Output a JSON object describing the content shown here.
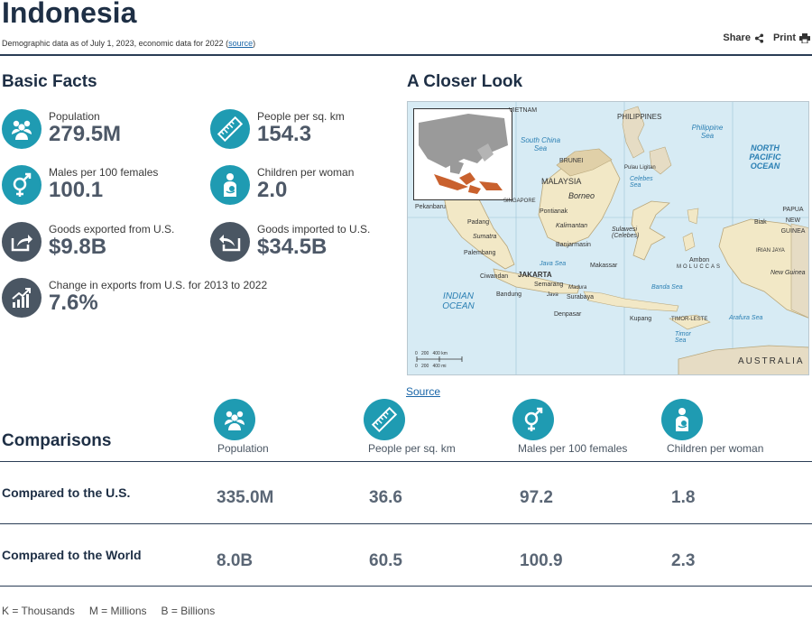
{
  "header": {
    "title": "Indonesia",
    "subtitle_prefix": "Demographic data as of July 1, 2023, economic data for 2022 (",
    "subtitle_link": "source",
    "subtitle_suffix": ")",
    "share_label": "Share",
    "print_label": "Print"
  },
  "basic_facts": {
    "heading": "Basic Facts",
    "items": [
      {
        "label": "Population",
        "value": "279.5M",
        "icon": "people-icon"
      },
      {
        "label": "People per sq. km",
        "value": "154.3",
        "icon": "ruler-icon"
      },
      {
        "label": "Males per 100 females",
        "value": "100.1",
        "icon": "gender-icon"
      },
      {
        "label": "Children per woman",
        "value": "2.0",
        "icon": "mother-child-icon"
      },
      {
        "label": "Goods exported from U.S.",
        "value": "$9.8B",
        "icon": "export-icon"
      },
      {
        "label": "Goods imported to U.S.",
        "value": "$34.5B",
        "icon": "import-icon"
      },
      {
        "label": "Change in exports from U.S. for 2013 to 2022",
        "value": "7.6%",
        "icon": "trend-chart-icon"
      }
    ]
  },
  "closer_look": {
    "heading": "A Closer Look",
    "source_link": "Source",
    "map_labels": {
      "philippines": "PHILIPPINES",
      "philippine_sea": "Philippine Sea",
      "south_china_sea": "South China Sea",
      "north_pacific": "NORTH PACIFIC OCEAN",
      "malaysia": "MALAYSIA",
      "borneo": "Borneo",
      "brunei": "BRUNEI",
      "celebes_sea": "Celebes Sea",
      "pulau": "Pulau Ligitan",
      "singapore": "SINGAPORE",
      "pekanbaru": "Pekanbaru",
      "padang": "Padang",
      "sumatra": "Sumatra",
      "palembang": "Palembang",
      "pontianak": "Pontianak",
      "kalimantan": "Kalimantan",
      "banjarmasin": "Banjarmasin",
      "sulawesi": "Sulawesi (Celebes)",
      "biak": "Biak",
      "papua": "PAPUA NEW GUINEA",
      "irian": "IRIAN JAYA",
      "new_guinea": "New Guinea",
      "ambon": "Ambon",
      "makassar": "Makassar",
      "moluccas": "MOLUCCAS",
      "java_sea": "Java Sea",
      "banda_sea": "Banda Sea",
      "jakarta": "JAKARTA",
      "ciwandan": "Ciwandan",
      "semarang": "Semarang",
      "bandung": "Bandung",
      "surabaya": "Surabaya",
      "java": "Java",
      "madura": "Madura",
      "denpasar": "Denpasar",
      "kupang": "Kupang",
      "timor_leste": "TIMOR-LESTE",
      "timor_sea": "Timor Sea",
      "arafura": "Arafura Sea",
      "indian_ocean": "INDIAN OCEAN",
      "australia": "AUSTRALIA",
      "vietnam": "VIETNAM",
      "scale_km": "0   200   400 km",
      "scale_mi": "0   200   400 mi"
    }
  },
  "comparisons": {
    "heading": "Comparisons",
    "columns": [
      "Population",
      "People per sq. km",
      "Males per 100 females",
      "Children per woman"
    ],
    "rows": [
      {
        "label": "Compared to the U.S.",
        "values": [
          "335.0M",
          "36.6",
          "97.2",
          "1.8"
        ]
      },
      {
        "label": "Compared to the World",
        "values": [
          "8.0B",
          "60.5",
          "100.9",
          "2.3"
        ]
      }
    ]
  },
  "legend": [
    "K = Thousands",
    "M = Millions",
    "B = Billions"
  ],
  "colors": {
    "teal": "#1f9bb2",
    "slate": "#4a5663",
    "navy": "#1e2f45"
  }
}
